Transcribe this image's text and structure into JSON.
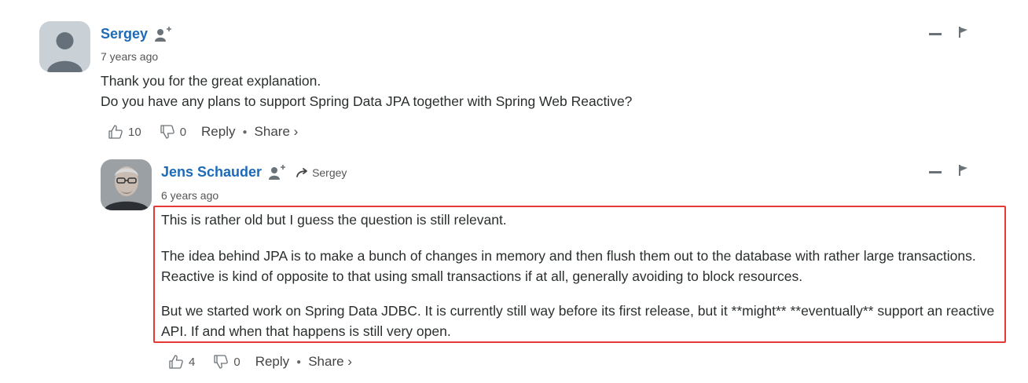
{
  "comments": [
    {
      "author": "Sergey",
      "time": "7 years ago",
      "paragraphs": [
        "Thank you for the great explanation.",
        "Do you have any plans to support Spring Data JPA together with Spring Web Reactive?"
      ],
      "upvotes": "10",
      "downvotes": "0",
      "reply_label": "Reply",
      "share_label": "Share ›"
    },
    {
      "author": "Jens Schauder",
      "reply_to": "Sergey",
      "time": "6 years ago",
      "paragraphs": [
        "This is rather old but I guess the question is still relevant.",
        "The idea behind JPA is to make a bunch of changes in memory and then flush them out to the database with rather large transactions. Reactive is kind of opposite to that using small transactions if at all, generally avoiding to block resources.",
        "But we started work on Spring Data JDBC. It is currently still way before its first release, but it **might** **eventually** support an reactive API. If and when that happens is still very open."
      ],
      "upvotes": "4",
      "downvotes": "0",
      "reply_label": "Reply",
      "share_label": "Share ›"
    }
  ],
  "colors": {
    "author_link": "#1d6bb8",
    "highlight_border": "#e53935"
  }
}
